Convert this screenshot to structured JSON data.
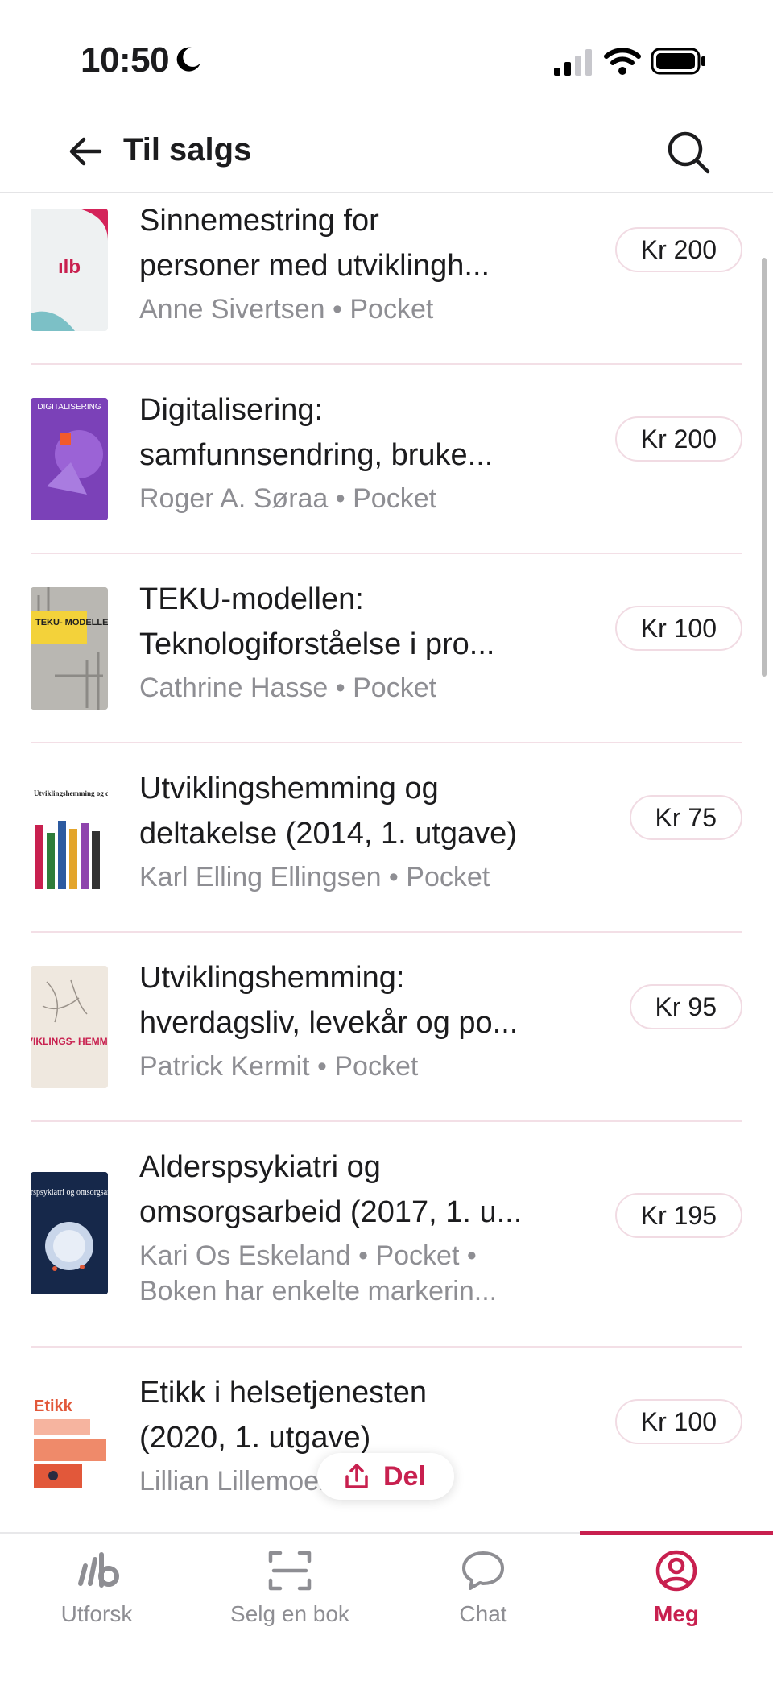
{
  "status_bar": {
    "time": "10:50"
  },
  "header": {
    "title": "Til salgs"
  },
  "items": [
    {
      "title_line1": "Sinnemestring for",
      "title_line2": "personer med utviklingh...",
      "meta_line1": "Anne Sivertsen • Pocket",
      "meta_line2": "",
      "price": "Kr 200",
      "cover_text": "ılb"
    },
    {
      "title_line1": "Digitalisering:",
      "title_line2": "samfunnsendring, bruke...",
      "meta_line1": "Roger A. Søraa • Pocket",
      "meta_line2": "",
      "price": "Kr 200",
      "cover_text": "DIGITALISERING"
    },
    {
      "title_line1": "TEKU-modellen:",
      "title_line2": "Teknologiforståelse i pro...",
      "meta_line1": "Cathrine Hasse • Pocket",
      "meta_line2": "",
      "price": "Kr 100",
      "cover_text": "TEKU- MODELLEN"
    },
    {
      "title_line1": "Utviklingshemming og",
      "title_line2": "deltakelse (2014, 1. utgave)",
      "meta_line1": "Karl Elling Ellingsen • Pocket",
      "meta_line2": "",
      "price": "Kr 75",
      "cover_text": "Utviklingshemming og deltakelse"
    },
    {
      "title_line1": "Utviklingshemming:",
      "title_line2": "hverdagsliv, levekår og po...",
      "meta_line1": "Patrick Kermit • Pocket",
      "meta_line2": "",
      "price": "Kr 95",
      "cover_text": "UTVIKLINGS- HEMMING"
    },
    {
      "title_line1": "Alderspsykiatri og",
      "title_line2": "omsorgsarbeid (2017, 1. u...",
      "meta_line1": "Kari Os Eskeland • Pocket •",
      "meta_line2": "Boken har enkelte markerin...",
      "price": "Kr 195",
      "cover_text": "Alderspsykiatri og omsorgsarbeid"
    },
    {
      "title_line1": "Etikk i helsetjenesten",
      "title_line2": "(2020, 1. utgave)",
      "meta_line1": "Lillian Lillemoen • Pocket",
      "meta_line2": "",
      "price": "Kr 100",
      "cover_text": "Etikk"
    }
  ],
  "share": {
    "label": "Del"
  },
  "tabs": [
    {
      "label": "Utforsk",
      "icon": "ulb-logo-icon"
    },
    {
      "label": "Selg en bok",
      "icon": "scan-icon"
    },
    {
      "label": "Chat",
      "icon": "chat-bubble-icon"
    },
    {
      "label": "Meg",
      "icon": "profile-icon"
    }
  ],
  "colors": {
    "accent": "#c8204f",
    "muted": "#8e8e93",
    "divider": "#f3dfe6"
  }
}
